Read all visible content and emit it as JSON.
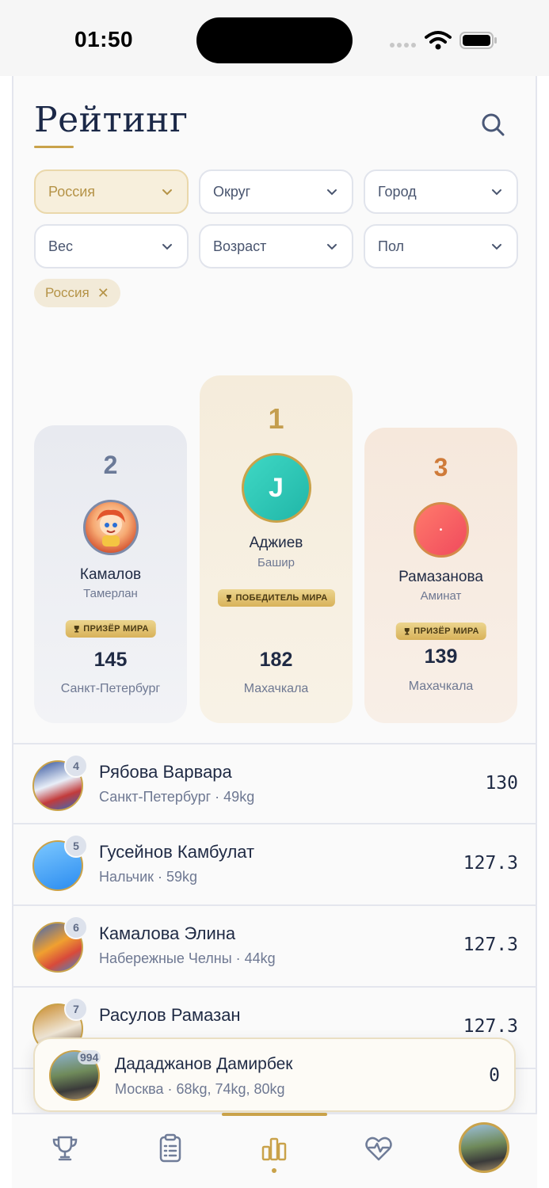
{
  "status_bar": {
    "time": "01:50"
  },
  "header": {
    "title": "Рейтинг"
  },
  "filters": [
    {
      "label": "Россия",
      "active": true
    },
    {
      "label": "Округ",
      "active": false
    },
    {
      "label": "Город",
      "active": false
    },
    {
      "label": "Вес",
      "active": false
    },
    {
      "label": "Возраст",
      "active": false
    },
    {
      "label": "Пол",
      "active": false
    }
  ],
  "active_chip": {
    "label": "Россия",
    "remove_icon": "✕"
  },
  "podium": {
    "first": {
      "rank": "1",
      "initial": "J",
      "last_name": "Аджиев",
      "first_name": "Башир",
      "badge": "ПОБЕДИТЕЛЬ МИРА",
      "score": "182",
      "city": "Махачкала"
    },
    "second": {
      "rank": "2",
      "last_name": "Камалов",
      "first_name": "Тамерлан",
      "badge": "ПРИЗЁР МИРА",
      "score": "145",
      "city": "Санкт-Петербург"
    },
    "third": {
      "rank": "3",
      "initial": "•",
      "last_name": "Рамазанова",
      "first_name": "Аминат",
      "badge": "ПРИЗЁР МИРА",
      "score": "139",
      "city": "Махачкала"
    }
  },
  "list": [
    {
      "rank": "4",
      "name": "Рябова Варвара",
      "sub": "Санкт-Петербург · 49kg",
      "score": "130"
    },
    {
      "rank": "5",
      "name": "Гусейнов Камбулат",
      "sub": "Нальчик · 59kg",
      "score": "127.3"
    },
    {
      "rank": "6",
      "name": "Камалова Элина",
      "sub": "Набережные Челны · 44kg",
      "score": "127.3"
    },
    {
      "rank": "7",
      "name": "Расулов Рамазан",
      "sub": "",
      "score": "127.3"
    }
  ],
  "me": {
    "rank": "994",
    "name": "Дададжанов Дамирбек",
    "sub": "Москва · 68kg, 74kg, 80kg",
    "score": "0"
  },
  "tabs": [
    "trophy-icon",
    "clipboard-icon",
    "rating-icon",
    "heart-pulse-icon",
    "profile-avatar"
  ],
  "colors": {
    "accent": "#c9a24a",
    "navy": "#1b2847"
  }
}
